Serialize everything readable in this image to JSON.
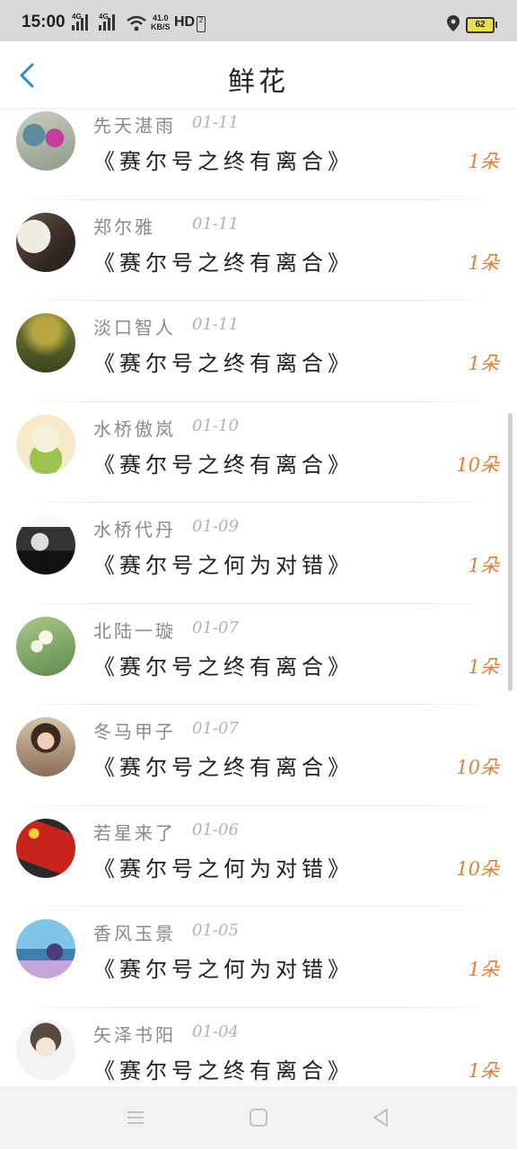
{
  "status_bar": {
    "time": "15:00",
    "signal1_tag": "4G",
    "signal2_tag": "4G",
    "speed_value": "41.0",
    "speed_unit": "KB/S",
    "hd_label": "HD",
    "hd_sub": "2",
    "battery": "62"
  },
  "header": {
    "title": "鲜花",
    "back_icon": "chevron-left-icon"
  },
  "accent_color": "#e0803a",
  "items": [
    {
      "name": "先天湛雨",
      "date": "01-11",
      "book": "《赛尔号之终有离合》",
      "count": "1朵"
    },
    {
      "name": "郑尔雅",
      "date": "01-11",
      "book": "《赛尔号之终有离合》",
      "count": "1朵"
    },
    {
      "name": "淡口智人",
      "date": "01-11",
      "book": "《赛尔号之终有离合》",
      "count": "1朵"
    },
    {
      "name": "水桥傲岚",
      "date": "01-10",
      "book": "《赛尔号之终有离合》",
      "count": "10朵"
    },
    {
      "name": "水桥代丹",
      "date": "01-09",
      "book": "《赛尔号之何为对错》",
      "count": "1朵"
    },
    {
      "name": "北陆一璇",
      "date": "01-07",
      "book": "《赛尔号之终有离合》",
      "count": "1朵"
    },
    {
      "name": "冬马甲子",
      "date": "01-07",
      "book": "《赛尔号之终有离合》",
      "count": "10朵"
    },
    {
      "name": "若星来了",
      "date": "01-06",
      "book": "《赛尔号之何为对错》",
      "count": "10朵"
    },
    {
      "name": "香风玉景",
      "date": "01-05",
      "book": "《赛尔号之何为对错》",
      "count": "1朵"
    },
    {
      "name": "矢泽书阳",
      "date": "01-04",
      "book": "《赛尔号之终有离合》",
      "count": "1朵"
    }
  ],
  "navbar": {
    "menu_icon": "menu-icon",
    "home_icon": "home-square-icon",
    "back_icon": "triangle-back-icon"
  }
}
